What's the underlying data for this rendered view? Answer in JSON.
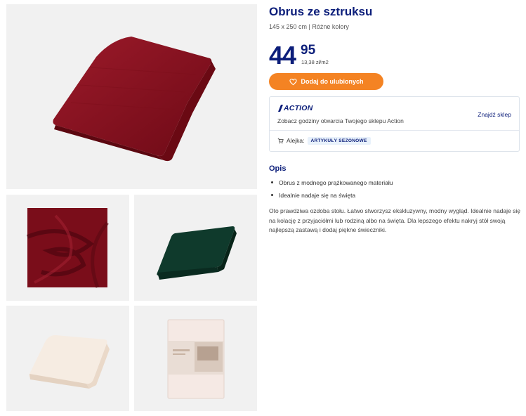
{
  "product": {
    "title": "Obrus ze sztruksu",
    "subtitle": "145 x 250 cm | Różne kolory",
    "price_main": "44",
    "price_cents": "95",
    "unit_price": "13,38 zł/m2",
    "favorite_label": "Dodaj do ulubionych"
  },
  "gallery": {
    "images": [
      {
        "name": "main",
        "subject": "burgundy folded corduroy tablecloth"
      },
      {
        "name": "detail",
        "subject": "burgundy fabric detail swirl"
      },
      {
        "name": "green",
        "subject": "dark green folded tablecloth"
      },
      {
        "name": "cream",
        "subject": "cream folded tablecloth"
      },
      {
        "name": "package",
        "subject": "packaged tablecloth"
      }
    ]
  },
  "store": {
    "brand": "ACTION",
    "hours_text": "Zobacz godziny otwarcia Twojego sklepu Action",
    "find_store_label": "Znajdź sklep",
    "aisle_label": "Alejka:",
    "aisle_value": "ARTYKUŁY SEZONOWE"
  },
  "description": {
    "heading": "Opis",
    "bullets": [
      "Obrus z modnego prążkowanego materiału",
      "Idealnie nadaje się na święta"
    ],
    "body": "Oto prawdziwa ozdoba stołu. Łatwo stworzysz ekskluzywny, modny wygląd. Idealnie nadaje się na kolację z przyjaciółmi lub rodziną albo na święta. Dla lepszego efektu nakryj stół swoją najlepszą zastawą i dodaj piękne świeczniki."
  },
  "colors": {
    "brand_blue": "#0c1e7a",
    "accent_orange": "#f48323",
    "burgundy": "#8a0e1e",
    "forest_green": "#0f3a2c",
    "cream": "#f6ece2"
  },
  "icons": {
    "favorite": "heart-icon",
    "cart": "cart-icon",
    "logo": "action-logo-icon"
  }
}
